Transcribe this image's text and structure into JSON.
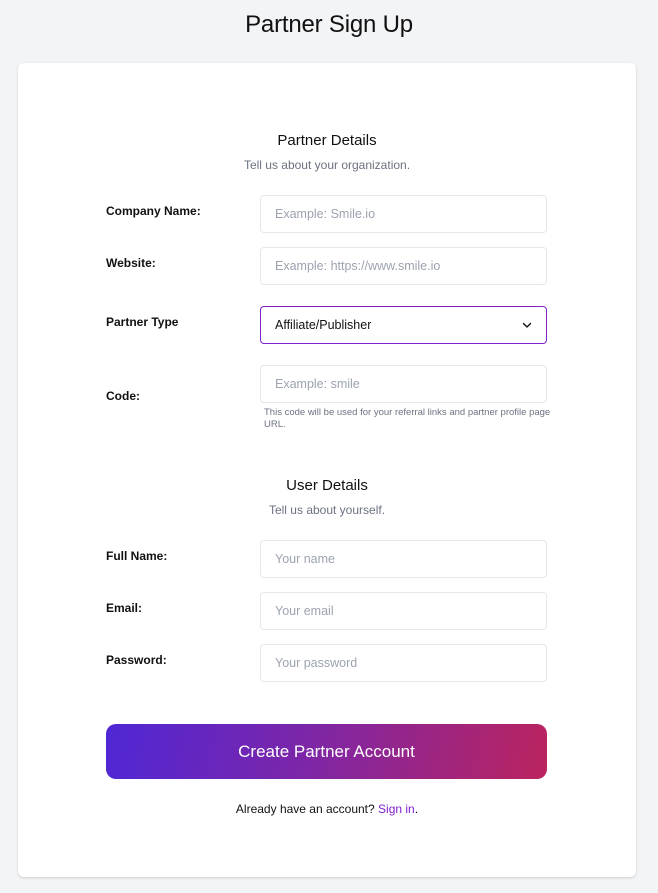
{
  "page": {
    "title": "Partner Sign Up"
  },
  "partner_details": {
    "title": "Partner Details",
    "subtitle": "Tell us about your organization.",
    "fields": {
      "company_name": {
        "label": "Company Name:",
        "placeholder": "Example: Smile.io",
        "value": ""
      },
      "website": {
        "label": "Website:",
        "placeholder": "Example: https://www.smile.io",
        "value": ""
      },
      "partner_type": {
        "label": "Partner Type",
        "selected": "Affiliate/Publisher"
      },
      "code": {
        "label": "Code:",
        "placeholder": "Example: smile",
        "value": "",
        "hint": "This code will be used for your referral links and partner profile page URL."
      }
    }
  },
  "user_details": {
    "title": "User Details",
    "subtitle": "Tell us about yourself.",
    "fields": {
      "full_name": {
        "label": "Full Name:",
        "placeholder": "Your name",
        "value": ""
      },
      "email": {
        "label": "Email:",
        "placeholder": "Your email",
        "value": ""
      },
      "password": {
        "label": "Password:",
        "placeholder": "Your password",
        "value": ""
      }
    }
  },
  "actions": {
    "submit_label": "Create Partner Account",
    "signin_prompt": "Already have an account?",
    "signin_link": "Sign in",
    "signin_suffix": "."
  },
  "colors": {
    "accent": "#7e22ce",
    "button_gradient_start": "#4f27d6",
    "button_gradient_end": "#bb245e",
    "background": "#f3f4f6"
  },
  "icons": {
    "select_chevron": "chevron-down-icon"
  }
}
